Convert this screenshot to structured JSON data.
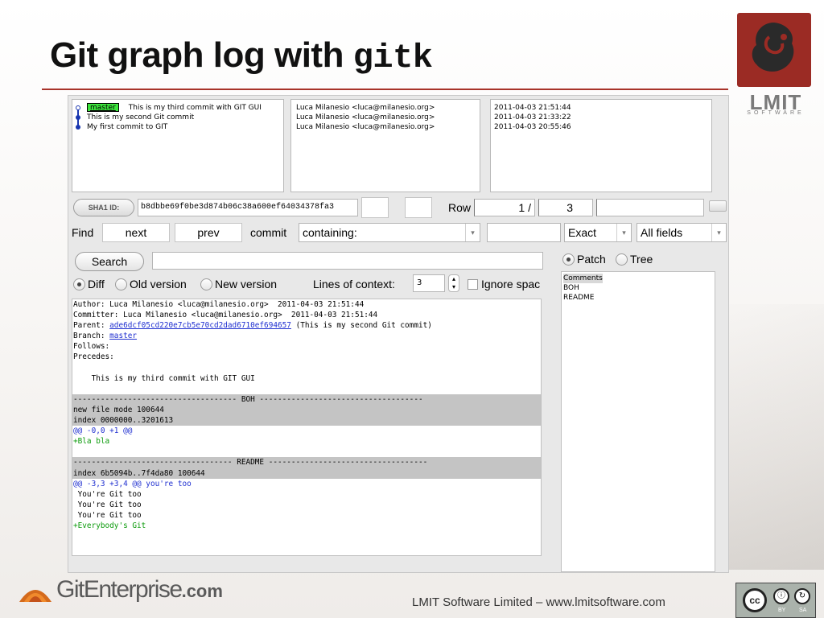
{
  "slide": {
    "title_text": "Git graph log with ",
    "title_code": "gitk",
    "logo_text": "LMIT",
    "logo_subtext": "SOFTWARE",
    "footer_brand": "GitEnterprise",
    "footer_brand_suffix": ".com",
    "footer_text": "LMIT Software Limited – www.lmitsoftware.com",
    "license_badge": {
      "cc": "cc",
      "by": "BY",
      "sa": "SA"
    },
    "accent_color": "#a8332a"
  },
  "gitk": {
    "commits": [
      {
        "branch": "master",
        "message": "This is my third commit with GIT GUI",
        "author": "Luca Milanesio <luca@milanesio.org>",
        "date": "2011-04-03 21:51:44"
      },
      {
        "branch": "",
        "message": "This is my second Git commit",
        "author": "Luca Milanesio <luca@milanesio.org>",
        "date": "2011-04-03 21:33:22"
      },
      {
        "branch": "",
        "message": "My first commit to GIT",
        "author": "Luca Milanesio <luca@milanesio.org>",
        "date": "2011-04-03 20:55:46"
      }
    ],
    "sha_label": "SHA1 ID:",
    "sha_value": "b8dbbe69f0be3d874b06c38a600ef64034378fa3",
    "row_label": "Row",
    "row_current": "1 /",
    "row_total": "3",
    "find": {
      "label": "Find",
      "next": "next",
      "prev": "prev",
      "commit_label": "commit",
      "containing": "containing:",
      "exact": "Exact",
      "all_fields": "All fields"
    },
    "search_label": "Search",
    "patch_label": "Patch",
    "tree_label": "Tree",
    "diff_label": "Diff",
    "old_version_label": "Old version",
    "new_version_label": "New version",
    "lines_context_label": "Lines of context:",
    "lines_context_value": "3",
    "ignore_space_label": "Ignore spac",
    "diff_lines": [
      {
        "text": "Author: Luca Milanesio <luca@milanesio.org>  2011-04-03 21:51:44",
        "style": ""
      },
      {
        "text": "Committer: Luca Milanesio <luca@milanesio.org>  2011-04-03 21:51:44",
        "style": ""
      },
      {
        "text": "Parent: ",
        "link": "ade6dcf05cd220e7cb5e70cd2dad6710ef694657",
        "after": " (This is my second Git commit)",
        "style": ""
      },
      {
        "text": "Branch: ",
        "link": "master",
        "after": "",
        "style": ""
      },
      {
        "text": "Follows:",
        "style": ""
      },
      {
        "text": "Precedes:",
        "style": ""
      },
      {
        "text": "",
        "style": ""
      },
      {
        "text": "    This is my third commit with GIT GUI",
        "style": ""
      },
      {
        "text": "",
        "style": ""
      },
      {
        "text": "------------------------------------ BOH ------------------------------------",
        "style": "hdr"
      },
      {
        "text": "new file mode 100644",
        "style": "hdr"
      },
      {
        "text": "index 0000000..3201613",
        "style": "hdr"
      },
      {
        "text": "@@ -0,0 +1 @@",
        "style": "blue"
      },
      {
        "text": "+Bla bla",
        "style": "green"
      },
      {
        "text": "",
        "style": ""
      },
      {
        "text": "----------------------------------- README -----------------------------------",
        "style": "hdr"
      },
      {
        "text": "index 6b5094b..7f4da80 100644",
        "style": "hdr"
      },
      {
        "text": "@@ -3,3 +3,4 @@ you're too",
        "style": "blue"
      },
      {
        "text": " You're Git too",
        "style": ""
      },
      {
        "text": " You're Git too",
        "style": ""
      },
      {
        "text": " You're Git too",
        "style": ""
      },
      {
        "text": "+Everybody's Git",
        "style": "green"
      }
    ],
    "files": [
      "Comments",
      "BOH",
      "README"
    ]
  }
}
